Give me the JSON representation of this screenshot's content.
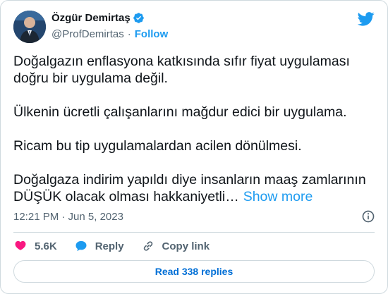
{
  "author": {
    "name": "Özgür Demirtaş",
    "handle": "@ProfDemirtas",
    "separator": "·",
    "follow_label": "Follow"
  },
  "tweet": {
    "paragraphs": [
      "Doğalgazın enflasyona katkısında sıfır fiyat uygulaması doğru bir uygulama değil.",
      "Ülkenin ücretli çalışanlarını mağdur edici bir uygulama.",
      "Ricam bu tip uygulamalardan acilen dönülmesi."
    ],
    "last_paragraph": "Doğalgaza indirim yapıldı diye insanların maaş zamlarının DÜŞÜK olacak olması hakkaniyetli…",
    "show_more_label": "Show more",
    "timestamp": "12:21 PM · Jun 5, 2023"
  },
  "actions": {
    "like_count": "5.6K",
    "reply_label": "Reply",
    "copy_link_label": "Copy link"
  },
  "read_replies_label": "Read 338 replies",
  "colors": {
    "accent": "#1d9bf0",
    "like": "#f91880",
    "text": "#0f1419",
    "muted": "#536471"
  },
  "icons": [
    "verified-badge-icon",
    "twitter-bird-icon",
    "info-icon",
    "heart-icon",
    "reply-bubble-icon",
    "link-icon"
  ]
}
